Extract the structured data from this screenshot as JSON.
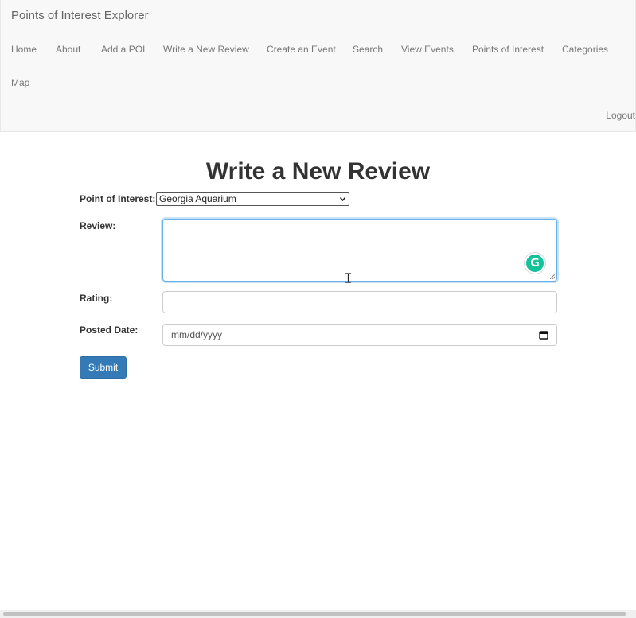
{
  "navbar": {
    "brand": "Points of Interest Explorer",
    "links": [
      "Home",
      "About",
      "Add a POI",
      "Write a New Review",
      "Create an Event",
      "Search",
      "View Events",
      "Points of Interest",
      "Categories",
      "Map"
    ],
    "logout": "Logout"
  },
  "page": {
    "title": "Write a New Review"
  },
  "form": {
    "poi_label": "Point of Interest:",
    "poi_selected": "Georgia Aquarium",
    "review_label": "Review:",
    "review_value": "",
    "rating_label": "Rating:",
    "rating_value": "",
    "date_label": "Posted Date:",
    "date_placeholder": "mm/dd/yyyy",
    "submit_label": "Submit"
  },
  "icons": {
    "grammarly": "grammarly-icon",
    "calendar": "calendar-icon",
    "dropdown": "chevron-down-icon",
    "cursor": "text-cursor-icon"
  },
  "colors": {
    "primary": "#337ab7",
    "focus": "#66afe9",
    "grammarly": "#15c39a",
    "navbar_bg": "#f8f8f8"
  }
}
